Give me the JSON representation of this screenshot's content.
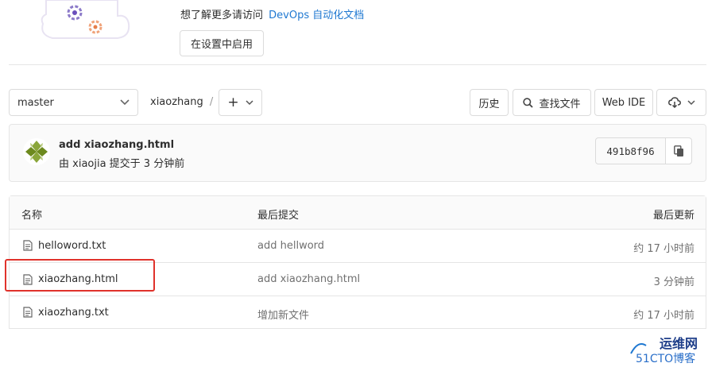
{
  "colors": {
    "link": "#1f78d1",
    "border": "#e5e5e5",
    "highlight_box": "#e0322b",
    "avatar_green": "#6d8a1e",
    "watermark": "#1f78d1"
  },
  "banner": {
    "info_prefix": "想了解更多请访问",
    "info_link": "DevOps 自动化文档",
    "enable_button": "在设置中启用",
    "illustration_icon": "gears-cloud-illustration"
  },
  "toolbar": {
    "branch": "master",
    "path": "xiaozhang",
    "path_separator": "/",
    "add_label": "+",
    "history": "历史",
    "find_file": "查找文件",
    "web_ide": "Web IDE",
    "download_icon": "cloud-download-icon"
  },
  "commit": {
    "title": "add xiaozhang.html",
    "byline": "由 xiaojia 提交于 3 分钟前",
    "sha": "491b8f96",
    "copy_icon": "copy-icon"
  },
  "file_table": {
    "headers": {
      "name": "名称",
      "last_commit": "最后提交",
      "last_update": "最后更新"
    },
    "rows": [
      {
        "name": "helloword.txt",
        "commit": "add hellword",
        "updated": "约 17 小时前"
      },
      {
        "name": "xiaozhang.html",
        "commit": "add xiaozhang.html",
        "updated": "3 分钟前"
      },
      {
        "name": "xiaozhang.txt",
        "commit": "增加新文件",
        "updated": "约 17 小时前"
      }
    ]
  },
  "watermark": {
    "line1": "运维网",
    "line2": "51CTO博客"
  }
}
